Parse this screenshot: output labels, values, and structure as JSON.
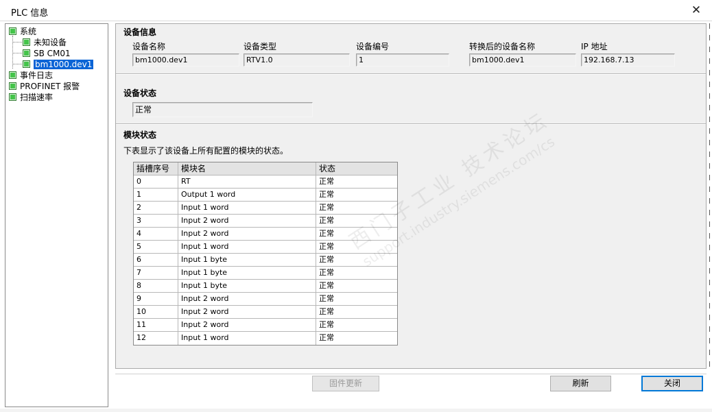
{
  "window": {
    "title": "PLC 信息",
    "close_glyph": "✕"
  },
  "tree": {
    "items": [
      {
        "label": "系统",
        "level": 0
      },
      {
        "label": "未知设备",
        "level": 1
      },
      {
        "label": "SB CM01",
        "level": 1
      },
      {
        "label": "bm1000.dev1",
        "level": 1,
        "selected": true
      },
      {
        "label": "事件日志",
        "level": 0
      },
      {
        "label": "PROFINET 报警",
        "level": 0
      },
      {
        "label": "扫描速率",
        "level": 0
      }
    ]
  },
  "device_info": {
    "title": "设备信息",
    "fields": [
      {
        "label": "设备名称",
        "value": "bm1000.dev1"
      },
      {
        "label": "设备类型",
        "value": "RTV1.0"
      },
      {
        "label": "设备编号",
        "value": "1"
      },
      {
        "label": "转换后的设备名称",
        "value": "bm1000.dev1"
      },
      {
        "label": "IP 地址",
        "value": "192.168.7.13"
      }
    ]
  },
  "device_status": {
    "title": "设备状态",
    "value": "正常"
  },
  "module_status": {
    "title": "模块状态",
    "description": "下表显示了该设备上所有配置的模块的状态。",
    "columns": [
      "插槽序号",
      "模块名",
      "状态"
    ],
    "rows": [
      [
        "0",
        "RT",
        "正常"
      ],
      [
        "1",
        "Output 1 word",
        "正常"
      ],
      [
        "2",
        "Input 1 word",
        "正常"
      ],
      [
        "3",
        "Input 2 word",
        "正常"
      ],
      [
        "4",
        "Input 2 word",
        "正常"
      ],
      [
        "5",
        "Input 1 word",
        "正常"
      ],
      [
        "6",
        "Input 1 byte",
        "正常"
      ],
      [
        "7",
        "Input 1 byte",
        "正常"
      ],
      [
        "8",
        "Input 1 byte",
        "正常"
      ],
      [
        "9",
        "Input 2 word",
        "正常"
      ],
      [
        "10",
        "Input 2 word",
        "正常"
      ],
      [
        "11",
        "Input 2 word",
        "正常"
      ],
      [
        "12",
        "Input 1 word",
        "正常"
      ]
    ]
  },
  "buttons": {
    "firmware_update": "固件更新",
    "refresh": "刷新",
    "close": "关闭"
  },
  "watermark": {
    "line1": "西门子工业 技术论坛",
    "line2": "support.industry.siemens.com/cs"
  },
  "colors": {
    "status_ok": "#44c44a",
    "selection": "#0a64d6",
    "default_button_border": "#0078d7"
  }
}
